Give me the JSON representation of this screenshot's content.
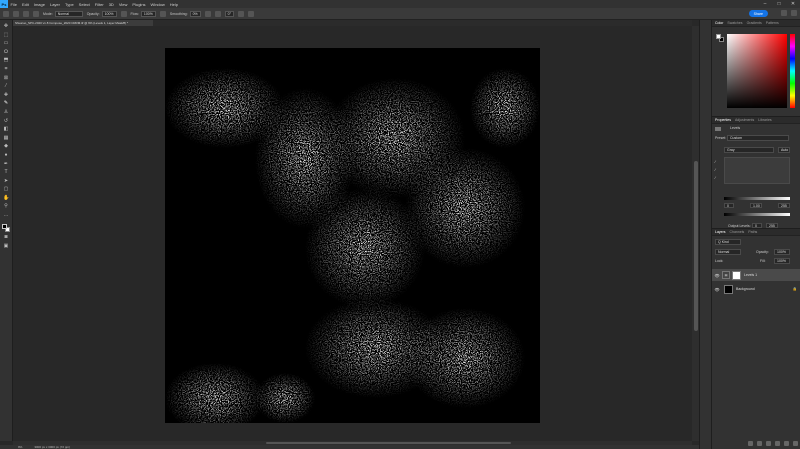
{
  "app": {
    "logo": "Ps",
    "menus": [
      "File",
      "Edit",
      "Image",
      "Layer",
      "Type",
      "Select",
      "Filter",
      "3D",
      "View",
      "Plugins",
      "Window",
      "Help"
    ],
    "window_controls": [
      "–",
      "□",
      "✕"
    ]
  },
  "options": {
    "mode_label": "Mode:",
    "mode_value": "Normal",
    "opacity_label": "Opacity:",
    "opacity_value": "100%",
    "flow_label": "Flow:",
    "flow_value": "100%",
    "smoothing_label": "Smoothing:",
    "smoothing_value": "0%",
    "angle_value": "0°",
    "share_label": "Share"
  },
  "document": {
    "tab_title": "Shuaruo_SPC-2020 v1.8 Compose_2020 CRRM.tif @ 9% (Levels 1, Layer Mask/8) *"
  },
  "status": {
    "zoom": "9%",
    "doc_size": "3000 px x 3000 px (72 ppi)"
  },
  "color_panel": {
    "tabs": [
      "Color",
      "Swatches",
      "Gradients",
      "Patterns"
    ]
  },
  "properties_panel": {
    "tabs": [
      "Properties",
      "Adjustments",
      "Libraries"
    ],
    "type_label": "Levels",
    "preset_label": "Preset:",
    "preset_value": "Custom",
    "channel_value": "Gray",
    "auto_label": "Auto",
    "input_values": [
      "0",
      "1.00",
      "255"
    ],
    "output_label": "Output Levels:",
    "output_values": [
      "0",
      "255"
    ]
  },
  "layers_panel": {
    "tabs": [
      "Layers",
      "Channels",
      "Paths"
    ],
    "kind_label": "Q Kind",
    "blend_value": "Normal",
    "opacity_label": "Opacity:",
    "opacity_value": "100%",
    "lock_label": "Lock:",
    "fill_label": "Fill:",
    "fill_value": "100%",
    "layers": [
      {
        "name": "Levels 1",
        "type": "adjustment"
      },
      {
        "name": "Background",
        "type": "pixel",
        "locked": true
      }
    ]
  }
}
